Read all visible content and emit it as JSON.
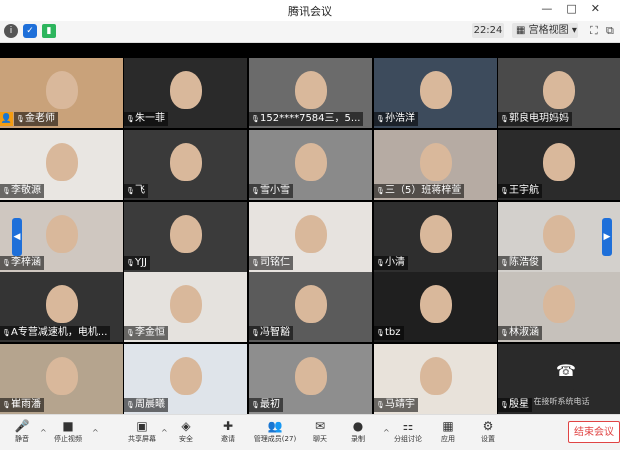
{
  "window": {
    "title": "腾讯会议",
    "time": "22:24",
    "view_label": "宫格视图"
  },
  "participants": [
    {
      "name": "金老师",
      "host": true,
      "bg": "#c9a27a"
    },
    {
      "name": "朱一菲",
      "bg": "#2a2a2a"
    },
    {
      "name": "152****7584三，5...",
      "bg": "#6b6b6b"
    },
    {
      "name": "孙浩洋",
      "bg": "#3d4b5c"
    },
    {
      "name": "郭良电玥妈妈",
      "bg": "#4a4a4a"
    },
    {
      "name": "李敬源",
      "bg": "#e9e6e2"
    },
    {
      "name": "飞",
      "bg": "#3a3a3a"
    },
    {
      "name": "雪小雪",
      "bg": "#8a8a8a"
    },
    {
      "name": "三（5）班蒋梓萱",
      "bg": "#b6aba3"
    },
    {
      "name": "王宇航",
      "bg": "#2b2b2b"
    },
    {
      "name": "李梓涵",
      "bg": "#cfc7c0"
    },
    {
      "name": "YJJ",
      "bg": "#3b3b3b"
    },
    {
      "name": "司铭仁",
      "bg": "#e7e3df"
    },
    {
      "name": "小清",
      "bg": "#2e2e2e"
    },
    {
      "name": "陈浩俊",
      "bg": "#d3d0cc"
    },
    {
      "name": "A专营减速机，电机...",
      "bg": "#343434"
    },
    {
      "name": "李金恒",
      "bg": "#e5e2de"
    },
    {
      "name": "冯智豁",
      "bg": "#5b5b5b"
    },
    {
      "name": "tbz",
      "bg": "#1f1f1f"
    },
    {
      "name": "林淑涵",
      "bg": "#c6c1bb"
    },
    {
      "name": "崔雨潘",
      "bg": "#b5a48e"
    },
    {
      "name": "周晨曦",
      "bg": "#dfe4ea"
    },
    {
      "name": "最初",
      "bg": "#8e8e8e"
    },
    {
      "name": "马靖宇",
      "bg": "#e8e2da"
    },
    {
      "name": "殷星",
      "bg": "#2a2a2a"
    }
  ],
  "phone_label": "在接听系统电话",
  "toolbar": [
    {
      "label": "静音",
      "icon": "mic-icon"
    },
    {
      "label": "停止视频",
      "icon": "camera-icon"
    },
    {
      "label": "共享屏幕",
      "icon": "share-screen-icon"
    },
    {
      "label": "安全",
      "icon": "shield-icon"
    },
    {
      "label": "邀请",
      "icon": "invite-icon"
    },
    {
      "label": "管理成员(27)",
      "icon": "members-icon"
    },
    {
      "label": "聊天",
      "icon": "chat-icon"
    },
    {
      "label": "录制",
      "icon": "record-icon"
    },
    {
      "label": "分组讨论",
      "icon": "breakout-icon"
    },
    {
      "label": "应用",
      "icon": "apps-icon"
    },
    {
      "label": "设置",
      "icon": "gear-icon"
    }
  ],
  "end_label": "结束会议"
}
